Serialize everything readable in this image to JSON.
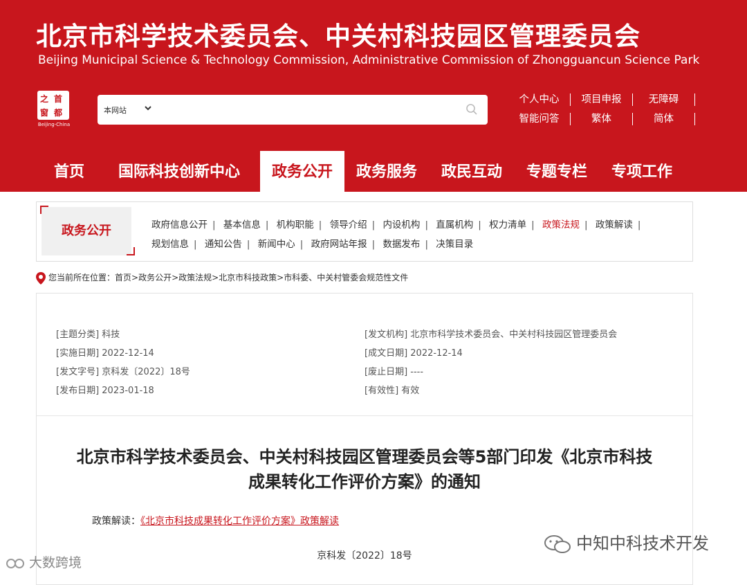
{
  "header": {
    "title_cn": "北京市科学技术委员会、中关村科技园区管理委员会",
    "title_en": "Beijing Municipal Science & Technology Commission, Administrative Commission of Zhongguancun Science Park",
    "logo": {
      "chars": [
        "之",
        "首",
        "窗",
        "都"
      ],
      "caption": "Beijing-China"
    },
    "search": {
      "scope": "本网站",
      "placeholder": ""
    },
    "links_row1": [
      "个人中心",
      "项目申报",
      "无障碍"
    ],
    "links_row2": [
      "智能问答",
      "繁体",
      "简体"
    ]
  },
  "nav": {
    "items": [
      "首页",
      "国际科技创新中心",
      "政务公开",
      "政务服务",
      "政民互动",
      "专题专栏",
      "专项工作"
    ],
    "active": "政务公开"
  },
  "subnav": {
    "title": "政务公开",
    "row1": [
      "政府信息公开",
      "基本信息",
      "机构职能",
      "领导介绍",
      "内设机构",
      "直属机构",
      "权力清单",
      "政策法规",
      "政策解读"
    ],
    "row2": [
      "规划信息",
      "通知公告",
      "新闻中心",
      "政府网站年报",
      "数据发布",
      "决策目录"
    ],
    "active": "政策法规"
  },
  "breadcrumb": {
    "prefix": "您当前所在位置：",
    "path": "首页>政务公开>政策法规>北京市科技政策>市科委、中关村管委会规范性文件"
  },
  "meta": {
    "topic": "[主题分类] 科技",
    "issuer": "[发文机构] 北京市科学技术委员会、中关村科技园区管理委员会",
    "effective": "[实施日期] 2022-12-14",
    "written": "[成文日期] 2022-12-14",
    "doc_no": "[发文字号] 京科发〔2022〕18号",
    "repeal": "[废止日期] ----",
    "published": "[发布日期] 2023-01-18",
    "validity": "[有效性] 有效"
  },
  "document": {
    "title": "北京市科学技术委员会、中关村科技园区管理委员会等5部门印发《北京市科技成果转化工作评价方案》的通知",
    "interp_label": "政策解读：",
    "interp_link": "《北京市科技成果转化工作评价方案》政策解读",
    "doc_no": "京科发〔2022〕18号"
  },
  "watermarks": {
    "right": "中知中科技术开发",
    "left": "大数跨境"
  },
  "colors": {
    "brand_red": "#c8161d",
    "white": "#ffffff"
  }
}
